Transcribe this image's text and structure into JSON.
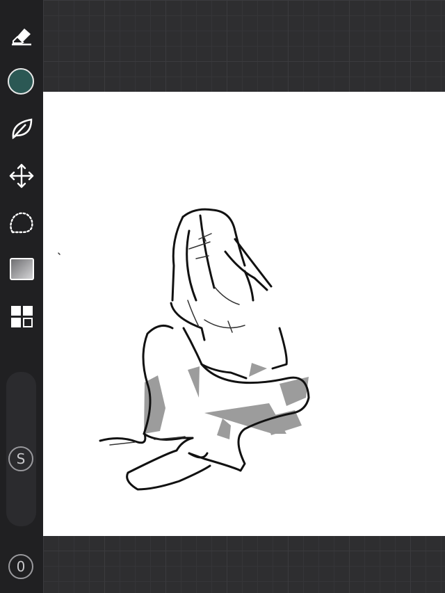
{
  "toolbar": {
    "tools": [
      {
        "name": "eraser-icon"
      },
      {
        "name": "color-swatch",
        "color": "#2b5854"
      },
      {
        "name": "leaf-icon"
      },
      {
        "name": "move-arrows-icon"
      },
      {
        "name": "lasso-selection-icon"
      },
      {
        "name": "gradient-square-icon"
      },
      {
        "name": "layers-grid-icon"
      }
    ],
    "slider_button_label": "S",
    "bottom_button_label": "0"
  },
  "colors": {
    "workspace_background": "#2e2e30",
    "toolbar_background": "#202022",
    "canvas_background": "#ffffff",
    "accent": "#2b5854"
  }
}
